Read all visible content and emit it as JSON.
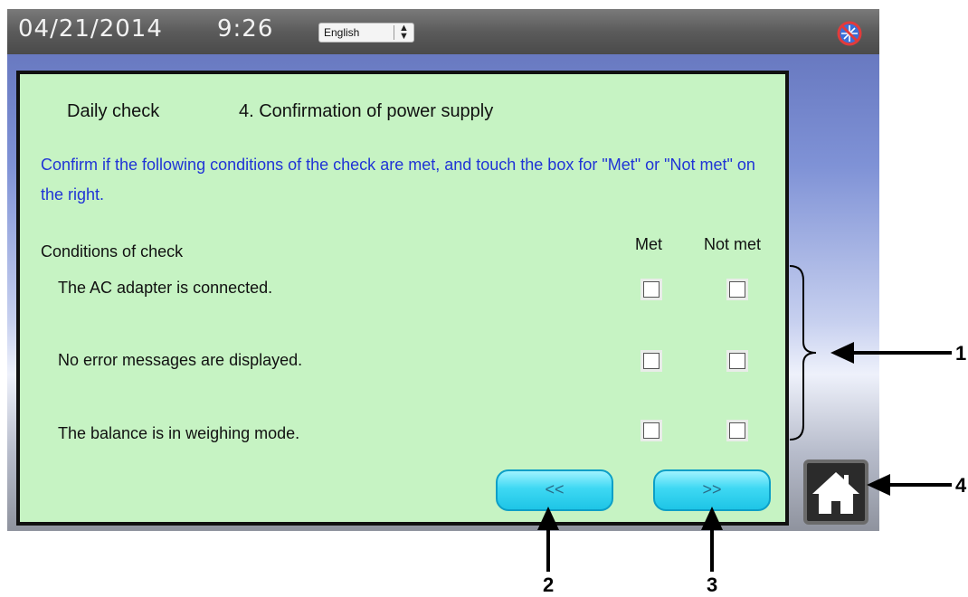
{
  "status_bar": {
    "date": "04/21/2014",
    "time": "9:26",
    "language": "English",
    "network_icon": "network-disconnected-icon"
  },
  "panel": {
    "section": "Daily check",
    "title": "4. Confirmation of power supply",
    "instruction": "Confirm if the following conditions of the check are met, and touch the box for \"Met\" or \"Not met\" on the right.",
    "columns": {
      "conditions": "Conditions of check",
      "met": "Met",
      "not_met": "Not met"
    },
    "conditions": [
      {
        "text": "The AC adapter is connected.",
        "met": false,
        "not_met": false
      },
      {
        "text": "No error messages are displayed.",
        "met": false,
        "not_met": false
      },
      {
        "text": "The balance is in weighing mode.",
        "met": false,
        "not_met": false
      }
    ],
    "prev_label": "<<",
    "next_label": ">>"
  },
  "home_button": {
    "icon": "home-icon"
  },
  "annotations": {
    "bracket": "1",
    "prev": "2",
    "next": "3",
    "home": "4"
  },
  "colors": {
    "panel_bg": "#c6f3c3",
    "instruction_text": "#2034d6",
    "nav_button": "#1ec5e6"
  }
}
